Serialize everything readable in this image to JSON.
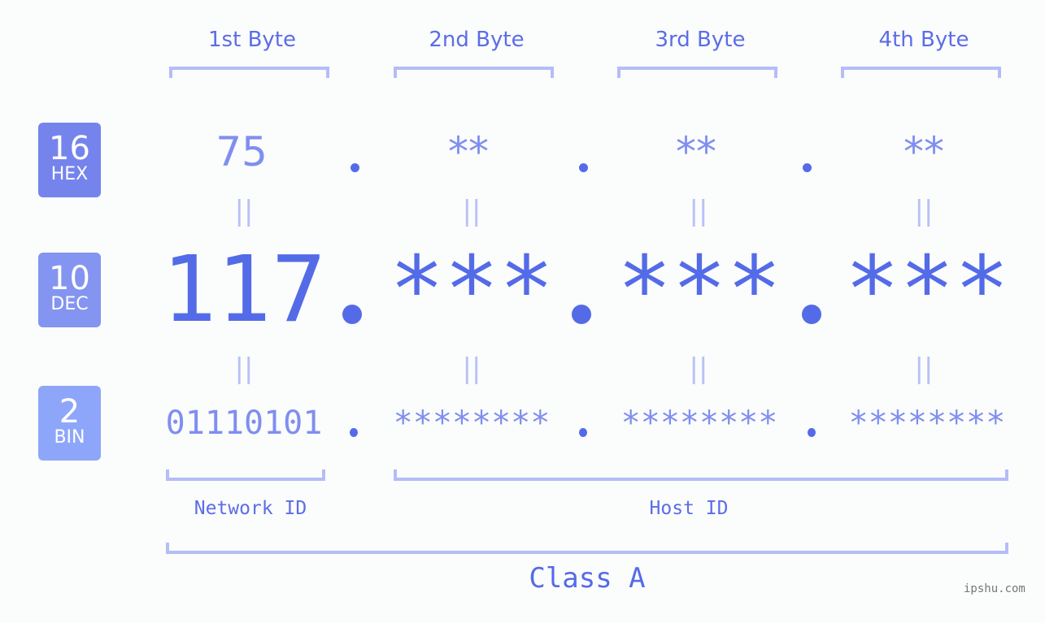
{
  "bytes": [
    {
      "label": "1st Byte",
      "hex": "75",
      "dec": "117",
      "bin": "01110101"
    },
    {
      "label": "2nd Byte",
      "hex": "**",
      "dec": "***",
      "bin": "********"
    },
    {
      "label": "3rd Byte",
      "hex": "**",
      "dec": "***",
      "bin": "********"
    },
    {
      "label": "4th Byte",
      "hex": "**",
      "dec": "***",
      "bin": "********"
    }
  ],
  "badges": {
    "hex": {
      "num": "16",
      "label": "HEX",
      "color": "#7584ec"
    },
    "dec": {
      "num": "10",
      "label": "DEC",
      "color": "#8494f1"
    },
    "bin": {
      "num": "2",
      "label": "BIN",
      "color": "#8ea6fa"
    }
  },
  "equals_sign": "||",
  "segments": {
    "network": "Network ID",
    "host": "Host ID"
  },
  "ip_class": "Class A",
  "watermark": "ipshu.com",
  "colors": {
    "accent": "#546be8",
    "light_accent": "#7f8ef0",
    "bracket": "#b4bdf7"
  }
}
